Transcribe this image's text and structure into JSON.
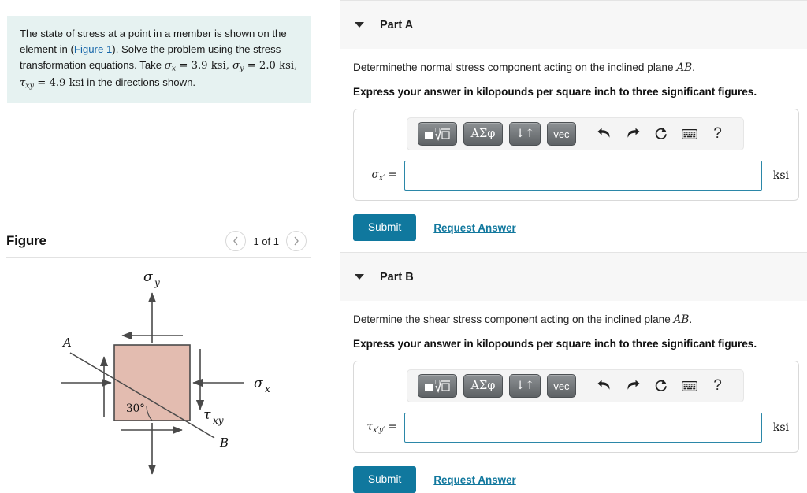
{
  "problem": {
    "text_part1": "The state of stress at a point in a member is shown on the element in (",
    "figure_link": "Figure 1",
    "text_part2": "). Solve the problem using the stress transformation equations. Take ",
    "given_1_symbol": "σ",
    "given_1_sub": "x",
    "given_1_value": " = 3.9 ksi, ",
    "given_2_symbol": "σ",
    "given_2_sub": "y",
    "given_2_value": " = 2.0 ksi, ",
    "given_3_symbol": "τ",
    "given_3_sub": "xy",
    "given_3_value": " = 4.9 ksi",
    "text_part3": " in the directions shown."
  },
  "figure_panel": {
    "title": "Figure",
    "prev_icon": "chevron-left-icon",
    "next_icon": "chevron-right-icon",
    "counter": "1 of 1"
  },
  "figure_diagram": {
    "label_sigma_y": "σ",
    "label_sigma_y_sub": "y",
    "label_sigma_x": "σ",
    "label_sigma_x_sub": "x",
    "label_tau_xy": "τ",
    "label_tau_xy_sub": "xy",
    "label_A": "A",
    "label_B": "B",
    "angle": "30°",
    "element_fill": "#e3bcb0",
    "element_stroke": "#4a4a4a"
  },
  "parts": [
    {
      "id": "part-a",
      "label": "Part A",
      "caret_icon": "caret-down-icon",
      "prompt": "Determinethe normal stress component acting on the inclined plane ",
      "prompt_math": "AB",
      "prompt_tail": ".",
      "instruction": "Express your answer in kilopounds per square inch to three significant figures.",
      "answer_label_symbol": "σ",
      "answer_label_sub": "x′",
      "answer_label_eq": " =",
      "answer_value": "",
      "answer_placeholder": "",
      "unit": "ksi",
      "submit_label": "Submit",
      "request_label": "Request Answer"
    },
    {
      "id": "part-b",
      "label": "Part B",
      "caret_icon": "caret-down-icon",
      "prompt": "Determine the shear stress component acting on the inclined plane ",
      "prompt_math": "AB",
      "prompt_tail": ".",
      "instruction": "Express your answer in kilopounds per square inch to three significant figures.",
      "answer_label_symbol": "τ",
      "answer_label_sub": "x′y′",
      "answer_label_eq": " =",
      "answer_value": "",
      "answer_placeholder": "",
      "unit": "ksi",
      "submit_label": "Submit",
      "request_label": "Request Answer"
    }
  ],
  "toolbar": {
    "buttons": [
      {
        "name": "math-template-button",
        "label": ""
      },
      {
        "name": "greek-symbols-button",
        "label": "ΑΣφ"
      },
      {
        "name": "updown-arrows-button",
        "label": "↓↑"
      },
      {
        "name": "vector-button",
        "label": "vec"
      }
    ],
    "icons": [
      {
        "name": "undo-icon"
      },
      {
        "name": "redo-icon"
      },
      {
        "name": "reset-icon"
      },
      {
        "name": "keyboard-icon"
      },
      {
        "name": "help-icon",
        "label": "?"
      }
    ]
  },
  "colors": {
    "accent_teal": "#10789e",
    "problem_bg": "#e6f2f1",
    "part_header_bg": "#f7f7f7",
    "input_border": "#2b87a8"
  }
}
